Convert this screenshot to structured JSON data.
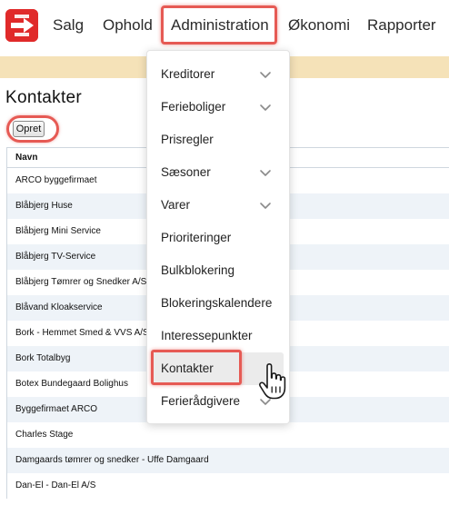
{
  "nav": {
    "items": [
      "Salg",
      "Ophold",
      "Administration",
      "Økonomi",
      "Rapporter"
    ]
  },
  "page": {
    "title": "Kontakter",
    "create_label": "Opret"
  },
  "table": {
    "header": "Navn",
    "rows": [
      "ARCO byggefirmaet",
      "Blåbjerg Huse",
      "Blåbjerg Mini Service",
      "Blåbjerg TV-Service",
      "Blåbjerg Tømrer og Snedker A/S",
      "Blåvand Kloakservice",
      "Bork - Hemmet Smed & VVS A/S",
      "Bork Totalbyg",
      "Botex Bundegaard Bolighus",
      "Byggefirmaet ARCO",
      "Charles Stage",
      "Damgaards tømrer og snedker - Uffe Damgaard",
      "Dan-El - Dan-El A/S"
    ]
  },
  "dropdown": {
    "items": [
      {
        "label": "Kreditorer",
        "has_submenu": true
      },
      {
        "label": "Ferieboliger",
        "has_submenu": true
      },
      {
        "label": "Prisregler",
        "has_submenu": false
      },
      {
        "label": "Sæsoner",
        "has_submenu": true
      },
      {
        "label": "Varer",
        "has_submenu": true
      },
      {
        "label": "Prioriteringer",
        "has_submenu": false
      },
      {
        "label": "Bulkblokering",
        "has_submenu": false
      },
      {
        "label": "Blokeringskalendere",
        "has_submenu": false
      },
      {
        "label": "Interessepunkter",
        "has_submenu": false
      },
      {
        "label": "Kontakter",
        "has_submenu": false
      },
      {
        "label": "Ferierådgivere",
        "has_submenu": true
      }
    ]
  },
  "colors": {
    "brand": "#e02a2a",
    "highlight": "#e65a54",
    "strip": "#f5e2b8",
    "row_alt": "#eef3f8"
  },
  "icons": {
    "logo": "brand-logo-icon",
    "submenu": "chevron-down-icon",
    "cursor": "hand-pointer-icon"
  }
}
